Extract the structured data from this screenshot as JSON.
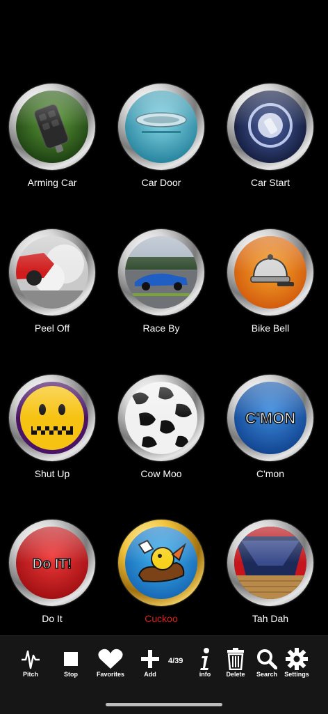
{
  "sounds": [
    {
      "label": "Arming Car",
      "icon": "car-key-fob-icon",
      "active": false
    },
    {
      "label": "Car Door",
      "icon": "car-door-handle-icon",
      "active": false
    },
    {
      "label": "Car Start",
      "icon": "ignition-key-icon",
      "active": false
    },
    {
      "label": "Peel Off",
      "icon": "tire-smoke-icon",
      "active": false
    },
    {
      "label": "Race By",
      "icon": "race-car-icon",
      "active": false
    },
    {
      "label": "Bike Bell",
      "icon": "bike-bell-icon",
      "active": false
    },
    {
      "label": "Shut Up",
      "icon": "zipper-mouth-face-icon",
      "active": false
    },
    {
      "label": "Cow Moo",
      "icon": "cow-pattern-icon",
      "active": false
    },
    {
      "label": "C'mon",
      "icon": "cmon-text-icon",
      "text": "C'MON",
      "active": false
    },
    {
      "label": "Do It",
      "icon": "do-it-text-icon",
      "text": "Do IT!",
      "active": false
    },
    {
      "label": "Cuckoo",
      "icon": "cuckoo-bird-icon",
      "active": true
    },
    {
      "label": "Tah Dah",
      "icon": "stage-curtain-icon",
      "active": false
    }
  ],
  "toolbar": {
    "pitch": "Pitch",
    "stop": "Stop",
    "favorites": "Favorites",
    "add": "Add",
    "page_counter": "4/39",
    "info": "info",
    "delete": "Delete",
    "search": "Search",
    "settings": "Settings"
  },
  "colors": {
    "background": "#000000",
    "active_label": "#e0211b",
    "toolbar": "#161616"
  }
}
